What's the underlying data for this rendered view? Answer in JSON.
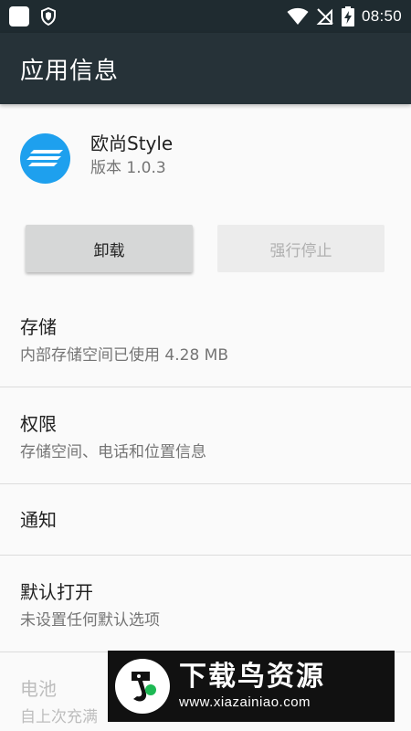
{
  "status_bar": {
    "time": "08:50",
    "icons": [
      "app-notification-icon",
      "shield-icon",
      "wifi-icon",
      "no-sim-icon",
      "battery-charging-icon"
    ]
  },
  "app_bar": {
    "title": "应用信息"
  },
  "app": {
    "name": "欧尚Style",
    "version": "版本 1.0.3",
    "icon_color": "#1ea0ee"
  },
  "buttons": {
    "uninstall_label": "卸载",
    "force_stop_label": "强行停止"
  },
  "settings": {
    "storage": {
      "title": "存储",
      "subtitle": "内部存储空间已使用 4.28 MB"
    },
    "permissions": {
      "title": "权限",
      "subtitle": "存储空间、电话和位置信息"
    },
    "notifications": {
      "title": "通知"
    },
    "open_by_default": {
      "title": "默认打开",
      "subtitle": "未设置任何默认选项"
    },
    "battery": {
      "title": "电池",
      "subtitle": "自上次充满"
    }
  },
  "watermark": {
    "title": "下载鸟资源",
    "url": "www.xiazainiao.com"
  },
  "colors": {
    "status_bar": "#1f2b30",
    "app_bar": "#263238",
    "background": "#fafafa"
  }
}
